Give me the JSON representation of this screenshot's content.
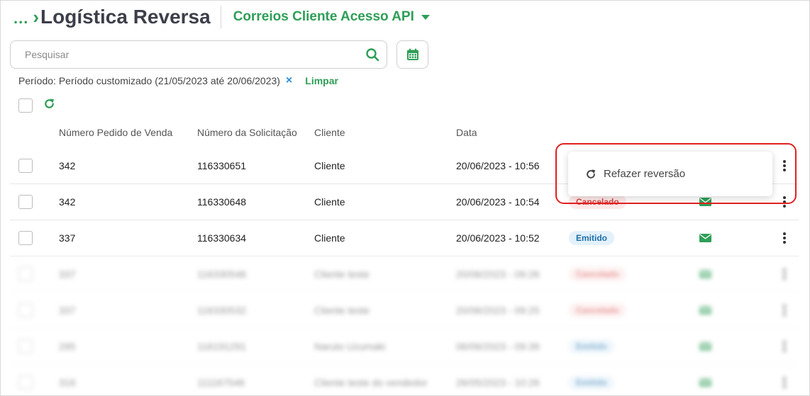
{
  "header": {
    "breadcrumb_dots": "...",
    "title": "Logística Reversa",
    "account": "Correios Cliente Acesso API"
  },
  "search": {
    "placeholder": "Pesquisar",
    "value": ""
  },
  "filter": {
    "label": "Período: Período customizado (21/05/2023 até 20/06/2023)",
    "remove": "×",
    "clear": "Limpar"
  },
  "table": {
    "columns": [
      "Número Pedido de Venda",
      "Número da Solicitação",
      "Cliente",
      "Data"
    ],
    "rows": [
      {
        "pedido": "342",
        "solicitacao": "116330651",
        "cliente": "Cliente",
        "data": "20/06/2023 - 10:56",
        "status": "",
        "status_type": "",
        "email": false
      },
      {
        "pedido": "342",
        "solicitacao": "116330648",
        "cliente": "Cliente",
        "data": "20/06/2023 - 10:54",
        "status": "Cancelado",
        "status_type": "cancelado",
        "email": true
      },
      {
        "pedido": "337",
        "solicitacao": "116330634",
        "cliente": "Cliente",
        "data": "20/06/2023 - 10:52",
        "status": "Emitido",
        "status_type": "emitido",
        "email": true
      },
      {
        "pedido": "337",
        "solicitacao": "116330546",
        "cliente": "Cliente teste",
        "data": "20/06/2023 - 09:26",
        "status": "Cancelado",
        "status_type": "cancelado",
        "email": true
      },
      {
        "pedido": "337",
        "solicitacao": "116330532",
        "cliente": "Cliente teste",
        "data": "20/06/2023 - 09:25",
        "status": "Cancelado",
        "status_type": "cancelado",
        "email": true
      },
      {
        "pedido": "295",
        "solicitacao": "116191291",
        "cliente": "Naruto Uzumaki",
        "data": "06/06/2023 - 09:39",
        "status": "Emitido",
        "status_type": "emitido",
        "email": true
      },
      {
        "pedido": "316",
        "solicitacao": "111167546",
        "cliente": "Cliente teste do vendedor",
        "data": "26/05/2023 - 10:26",
        "status": "Emitido",
        "status_type": "emitido",
        "email": true
      }
    ]
  },
  "row_menu": {
    "refazer_label": "Refazer reversão"
  },
  "colors": {
    "brand_green": "#2e9e57",
    "accent_blue": "#2b8fd6",
    "highlight_red": "#e02020"
  },
  "icons": {
    "search": "search-icon",
    "calendar": "calendar-icon",
    "refresh": "refresh-icon",
    "email": "envelope-icon",
    "more": "kebab-menu-icon"
  }
}
